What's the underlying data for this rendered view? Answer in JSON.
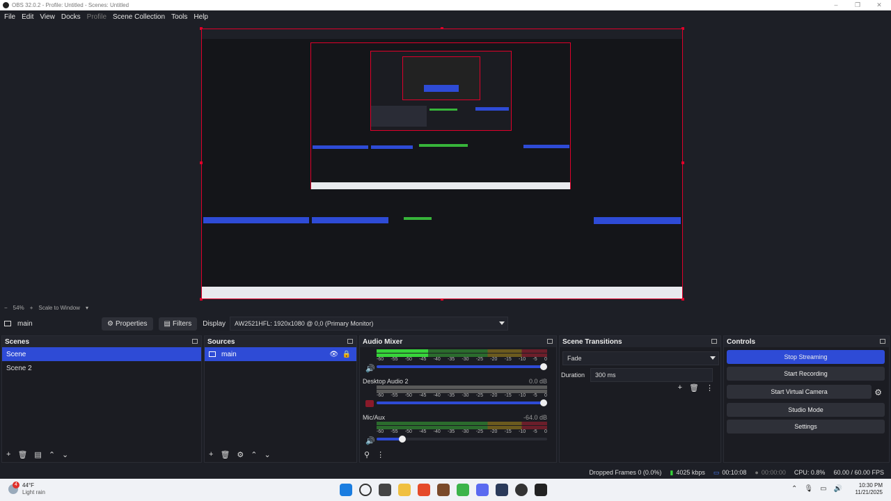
{
  "window": {
    "title": "OBS 32.0.2 - Profile: Untitled - Scenes: Untitled"
  },
  "menu": [
    {
      "label": "File",
      "disabled": false
    },
    {
      "label": "Edit",
      "disabled": false
    },
    {
      "label": "View",
      "disabled": false
    },
    {
      "label": "Docks",
      "disabled": false
    },
    {
      "label": "Profile",
      "disabled": true
    },
    {
      "label": "Scene Collection",
      "disabled": false
    },
    {
      "label": "Tools",
      "disabled": false
    },
    {
      "label": "Help",
      "disabled": false
    }
  ],
  "zoom": {
    "minus": "−",
    "value": "54%",
    "plus": "+",
    "mode": "Scale to Window"
  },
  "toolbar": {
    "source": "main",
    "properties": "Properties",
    "filters": "Filters",
    "display_label": "Display",
    "display_value": "AW2521HFL: 1920x1080 @ 0,0 (Primary Monitor)"
  },
  "scenes": {
    "title": "Scenes",
    "items": [
      "Scene",
      "Scene 2"
    ],
    "selected": 0
  },
  "sources": {
    "title": "Sources",
    "items": [
      "main"
    ]
  },
  "audio": {
    "title": "Audio Mixer",
    "scale": [
      "-60",
      "-55",
      "-50",
      "-45",
      "-40",
      "-35",
      "-30",
      "-25",
      "-20",
      "-15",
      "-10",
      "-5",
      "0"
    ],
    "channels": [
      {
        "name": "",
        "db": "",
        "level": 0.3,
        "volume": 1.0,
        "muted": false
      },
      {
        "name": "Desktop Audio 2",
        "db": "0.0 dB",
        "level": 0.0,
        "volume": 1.0,
        "muted": true
      },
      {
        "name": "Mic/Aux",
        "db": "-64.0 dB",
        "level": 0.0,
        "volume": 0.16,
        "muted": false
      }
    ]
  },
  "transitions": {
    "title": "Scene Transitions",
    "type": "Fade",
    "duration_label": "Duration",
    "duration": "300 ms"
  },
  "controls": {
    "title": "Controls",
    "stop_streaming": "Stop Streaming",
    "start_recording": "Start Recording",
    "start_virtual_camera": "Start Virtual Camera",
    "studio_mode": "Studio Mode",
    "settings": "Settings"
  },
  "status": {
    "dropped": "Dropped Frames 0 (0.0%)",
    "bitrate": "4025 kbps",
    "stream_time": "00:10:08",
    "rec_time": "00:00:00",
    "cpu": "CPU: 0.8%",
    "fps": "60.00 / 60.00 FPS"
  },
  "taskbar": {
    "temp": "44°F",
    "weather": "Light rain",
    "badge": "4",
    "time": "10:30 PM",
    "date": "11/21/2025"
  },
  "colors": {
    "accent": "#2e4bd6",
    "selection_border": "#e0002a"
  }
}
